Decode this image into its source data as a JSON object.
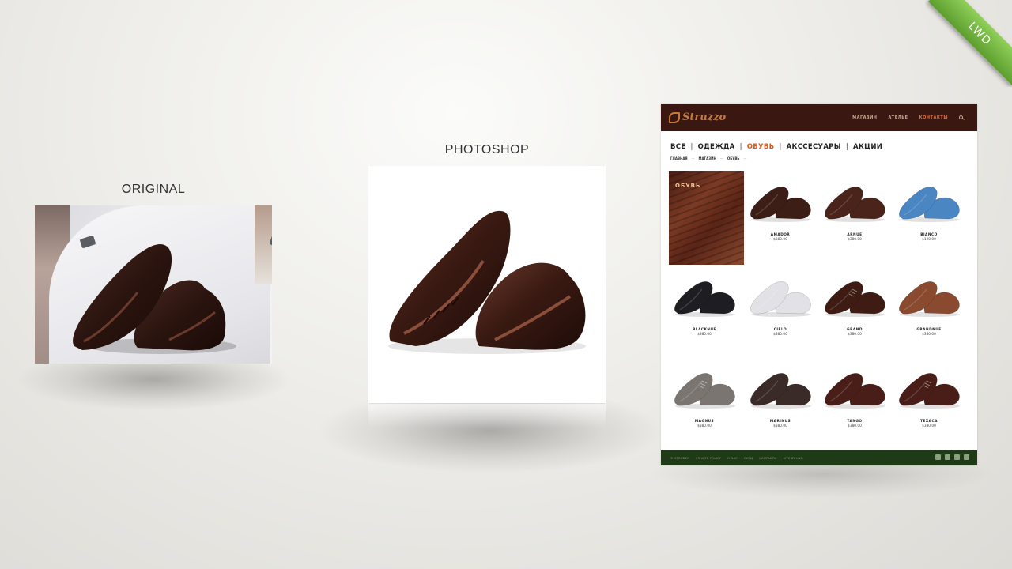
{
  "badge": "LWD",
  "panels": {
    "original_caption": "ORIGINAL",
    "photoshop_caption": "PHOTOSHOP"
  },
  "site": {
    "logo": "Struzzo",
    "top_nav": [
      {
        "label": "МАГАЗИН",
        "active": false
      },
      {
        "label": "АТЕЛЬЕ",
        "active": false
      },
      {
        "label": "КОНТАКТЫ",
        "active": true
      }
    ],
    "categories": [
      {
        "label": "ВСЕ",
        "active": false
      },
      {
        "label": "ОДЕЖДА",
        "active": false
      },
      {
        "label": "ОБУВЬ",
        "active": true
      },
      {
        "label": "АКССЕСУАРЫ",
        "active": false
      },
      {
        "label": "АКЦИИ",
        "active": false
      }
    ],
    "breadcrumbs": [
      "ГЛАВНАЯ",
      "МАГАЗИН",
      "ОБУВЬ"
    ],
    "feature_label": "ОБУВЬ",
    "products": [
      {
        "name": "AMADOR",
        "price": "$380.00",
        "color": "#3d1e16",
        "style": "loafer"
      },
      {
        "name": "ARNUE",
        "price": "$380.00",
        "color": "#4a241a",
        "style": "loafer"
      },
      {
        "name": "BIANCO",
        "price": "$190.00",
        "color": "#4a86c2",
        "style": "loafer"
      },
      {
        "name": "BLACKNUE",
        "price": "$380.00",
        "color": "#1e1e22",
        "style": "loafer"
      },
      {
        "name": "CIELO",
        "price": "$380.00",
        "color": "#e2e2e6",
        "style": "loafer"
      },
      {
        "name": "GRAND",
        "price": "$380.00",
        "color": "#3e1c14",
        "style": "lace"
      },
      {
        "name": "GRANDNUE",
        "price": "$380.00",
        "color": "#8a4a30",
        "style": "loafer"
      },
      {
        "name": "MAGNUS",
        "price": "$380.00",
        "color": "#7a7570",
        "style": "lace"
      },
      {
        "name": "MARINUS",
        "price": "$380.00",
        "color": "#3a2a28",
        "style": "loafer"
      },
      {
        "name": "TANGO",
        "price": "$380.00",
        "color": "#4a1e18",
        "style": "loafer"
      },
      {
        "name": "TEXACA",
        "price": "$380.00",
        "color": "#4a1e18",
        "style": "lace"
      }
    ],
    "footer_links": [
      "© STRUZZO",
      "PRIVATE POLICY",
      "О НАС",
      "УХОД",
      "КОНТАКТЫ",
      "SITE BY LWD"
    ],
    "social_icons": [
      "facebook-icon",
      "instagram-icon",
      "vk-icon",
      "youtube-icon"
    ]
  }
}
